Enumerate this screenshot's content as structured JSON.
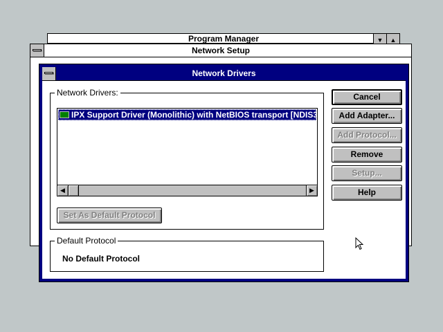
{
  "program_manager": {
    "title": "Program Manager"
  },
  "network_setup": {
    "title": "Network Setup"
  },
  "network_drivers": {
    "title": "Network Drivers",
    "drivers_group_label": "Network Drivers:",
    "drivers_list": [
      {
        "label": "IPX Support Driver (Monolithic) with NetBIOS transport [NDIS3",
        "icon": "network-card-icon",
        "selected": true
      }
    ],
    "set_default_button": "Set As Default Protocol",
    "default_group_label": "Default Protocol",
    "default_protocol_value": "No Default Protocol",
    "buttons": {
      "cancel": "Cancel",
      "add_adapter": "Add Adapter...",
      "add_protocol": "Add Protocol...",
      "remove": "Remove",
      "setup": "Setup...",
      "help": "Help"
    }
  },
  "colors": {
    "desktop": "#c0c7c8",
    "active_caption": "#000080",
    "button_face": "#c0c0c0"
  }
}
